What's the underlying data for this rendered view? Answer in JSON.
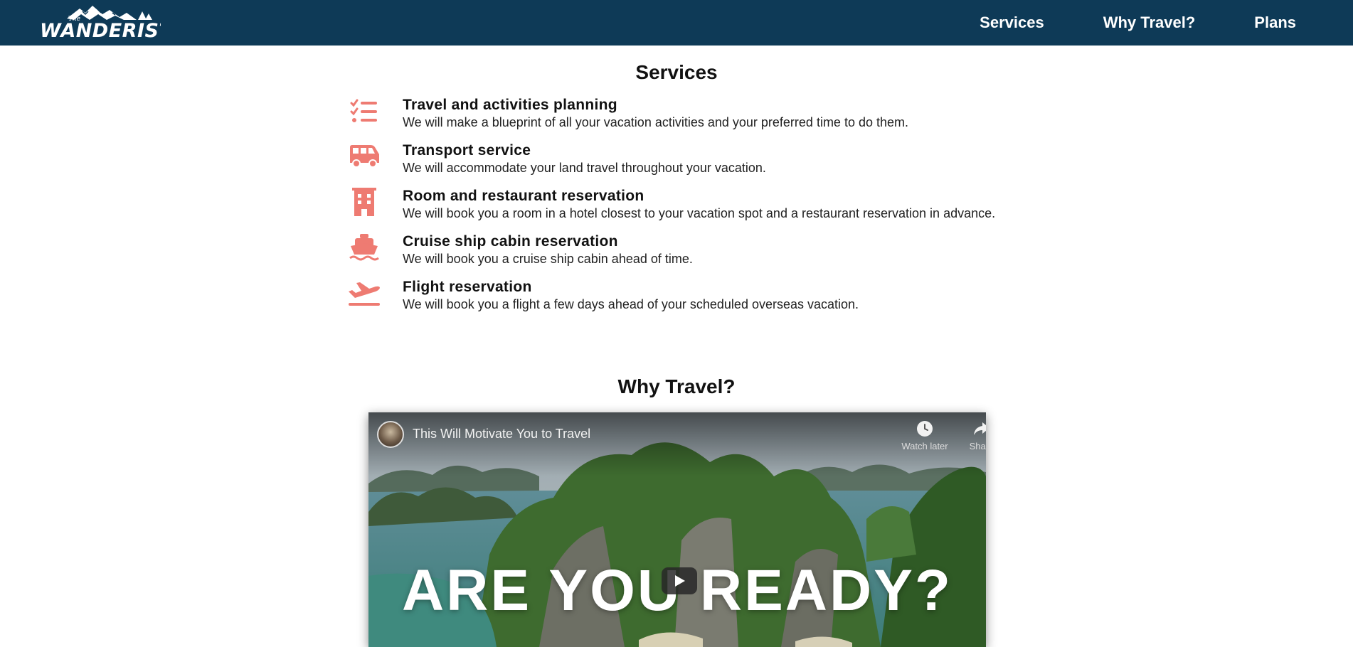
{
  "brand": {
    "logo_text": "WANDERIST",
    "logo_small": "The"
  },
  "nav": {
    "items": [
      "Services",
      "Why Travel?",
      "Plans"
    ]
  },
  "services": {
    "title": "Services",
    "items": [
      {
        "icon": "checklist-icon",
        "title": "Travel and activities planning",
        "description": "We will make a blueprint of all your vacation activities and your preferred time to do them."
      },
      {
        "icon": "bus-icon",
        "title": "Transport service",
        "description": "We will accommodate your land travel throughout your vacation."
      },
      {
        "icon": "hotel-building-icon",
        "title": "Room and restaurant reservation",
        "description": "We will book you a room in a hotel closest to your vacation spot and a restaurant reservation in advance."
      },
      {
        "icon": "ship-icon",
        "title": "Cruise ship cabin reservation",
        "description": "We will book you a cruise ship cabin ahead of time."
      },
      {
        "icon": "plane-departure-icon",
        "title": "Flight reservation",
        "description": "We will book you a flight a few days ahead of your scheduled overseas vacation."
      }
    ]
  },
  "why_travel": {
    "title": "Why Travel?",
    "video": {
      "title": "This Will Motivate You to Travel",
      "watch_later": "Watch later",
      "share": "Share",
      "headline": "ARE YOU READY?"
    }
  },
  "colors": {
    "navbar": "#0e3a57",
    "icon_accent": "#ee7b72",
    "text": "#111111"
  }
}
